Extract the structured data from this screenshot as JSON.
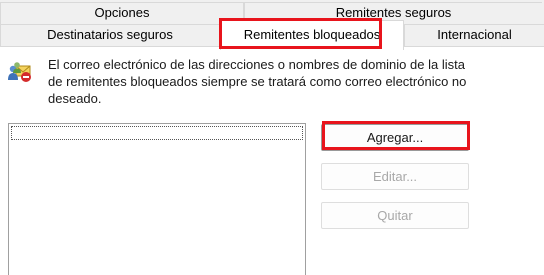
{
  "tabs": {
    "row_back": [
      {
        "label": "Opciones"
      },
      {
        "label": "Remitentes seguros"
      }
    ],
    "row_front": [
      {
        "label": "Destinatarios seguros"
      },
      {
        "label": "Remitentes bloqueados",
        "selected": true
      },
      {
        "label": "Internacional"
      }
    ]
  },
  "content": {
    "icon": "blocked-senders-icon",
    "description": "El correo electrónico de las direcciones o nombres de dominio de la lista de remitentes bloqueados siempre se tratará como correo electrónico no deseado.",
    "list_items": []
  },
  "buttons": {
    "add": {
      "label": "Agregar...",
      "enabled": true
    },
    "edit": {
      "label": "Editar...",
      "enabled": false
    },
    "remove": {
      "label": "Quitar",
      "enabled": false
    }
  },
  "colors": {
    "highlight": "#e8141c",
    "panel_bg": "#ffffff",
    "tab_bg": "#f0f0f0",
    "disabled_text": "#a8a8a8"
  }
}
